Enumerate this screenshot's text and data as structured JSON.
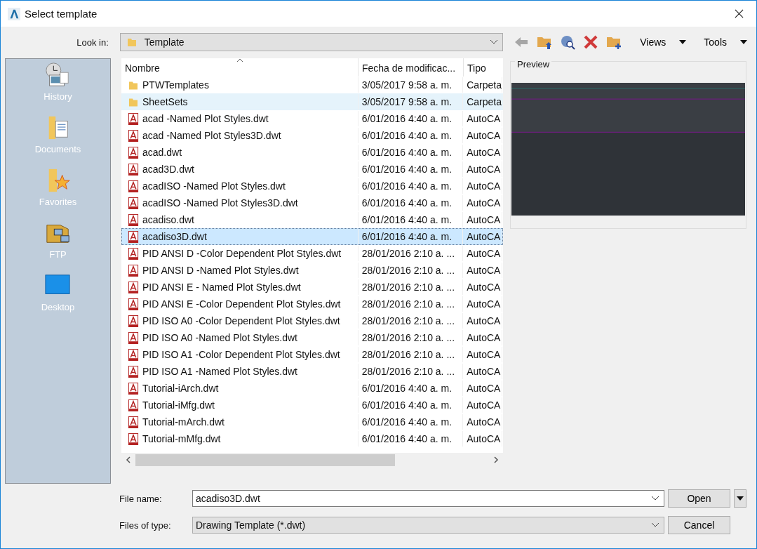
{
  "window": {
    "title": "Select template"
  },
  "look_in": {
    "label": "Look in:",
    "value": "Template"
  },
  "toolbar": {
    "views": "Views",
    "tools": "Tools"
  },
  "places": [
    {
      "label": "History",
      "kind": "history"
    },
    {
      "label": "Documents",
      "kind": "documents"
    },
    {
      "label": "Favorites",
      "kind": "favorites"
    },
    {
      "label": "FTP",
      "kind": "ftp"
    },
    {
      "label": "Desktop",
      "kind": "desktop"
    }
  ],
  "file_list": {
    "columns": [
      "Nombre",
      "Fecha de modificac...",
      "Tipo"
    ],
    "rows": [
      {
        "name": "PTWTemplates",
        "date": "3/05/2017 9:58 a. m.",
        "type": "Carpeta",
        "kind": "folder",
        "selected": false,
        "hovered": false
      },
      {
        "name": "SheetSets",
        "date": "3/05/2017 9:58 a. m.",
        "type": "Carpeta",
        "kind": "folder",
        "selected": false,
        "hovered": true
      },
      {
        "name": "acad -Named Plot Styles.dwt",
        "date": "6/01/2016 4:40 a. m.",
        "type": "AutoCA",
        "kind": "dwt",
        "selected": false,
        "hovered": false
      },
      {
        "name": "acad -Named Plot Styles3D.dwt",
        "date": "6/01/2016 4:40 a. m.",
        "type": "AutoCA",
        "kind": "dwt",
        "selected": false,
        "hovered": false
      },
      {
        "name": "acad.dwt",
        "date": "6/01/2016 4:40 a. m.",
        "type": "AutoCA",
        "kind": "dwt",
        "selected": false,
        "hovered": false
      },
      {
        "name": "acad3D.dwt",
        "date": "6/01/2016 4:40 a. m.",
        "type": "AutoCA",
        "kind": "dwt",
        "selected": false,
        "hovered": false
      },
      {
        "name": "acadISO -Named Plot Styles.dwt",
        "date": "6/01/2016 4:40 a. m.",
        "type": "AutoCA",
        "kind": "dwt",
        "selected": false,
        "hovered": false
      },
      {
        "name": "acadISO -Named Plot Styles3D.dwt",
        "date": "6/01/2016 4:40 a. m.",
        "type": "AutoCA",
        "kind": "dwt",
        "selected": false,
        "hovered": false
      },
      {
        "name": "acadiso.dwt",
        "date": "6/01/2016 4:40 a. m.",
        "type": "AutoCA",
        "kind": "dwt",
        "selected": false,
        "hovered": false
      },
      {
        "name": "acadiso3D.dwt",
        "date": "6/01/2016 4:40 a. m.",
        "type": "AutoCA",
        "kind": "dwt",
        "selected": true,
        "hovered": false
      },
      {
        "name": "PID ANSI D -Color Dependent Plot Styles.dwt",
        "date": "28/01/2016 2:10 a. ...",
        "type": "AutoCA",
        "kind": "dwt",
        "selected": false,
        "hovered": false
      },
      {
        "name": "PID ANSI D -Named Plot Styles.dwt",
        "date": "28/01/2016 2:10 a. ...",
        "type": "AutoCA",
        "kind": "dwt",
        "selected": false,
        "hovered": false
      },
      {
        "name": "PID ANSI E - Named Plot Styles.dwt",
        "date": "28/01/2016 2:10 a. ...",
        "type": "AutoCA",
        "kind": "dwt",
        "selected": false,
        "hovered": false
      },
      {
        "name": "PID ANSI E -Color Dependent Plot Styles.dwt",
        "date": "28/01/2016 2:10 a. ...",
        "type": "AutoCA",
        "kind": "dwt",
        "selected": false,
        "hovered": false
      },
      {
        "name": "PID ISO A0 -Color Dependent Plot Styles.dwt",
        "date": "28/01/2016 2:10 a. ...",
        "type": "AutoCA",
        "kind": "dwt",
        "selected": false,
        "hovered": false
      },
      {
        "name": "PID ISO A0 -Named Plot Styles.dwt",
        "date": "28/01/2016 2:10 a. ...",
        "type": "AutoCA",
        "kind": "dwt",
        "selected": false,
        "hovered": false
      },
      {
        "name": "PID ISO A1 -Color Dependent Plot Styles.dwt",
        "date": "28/01/2016 2:10 a. ...",
        "type": "AutoCA",
        "kind": "dwt",
        "selected": false,
        "hovered": false
      },
      {
        "name": "PID ISO A1 -Named Plot Styles.dwt",
        "date": "28/01/2016 2:10 a. ...",
        "type": "AutoCA",
        "kind": "dwt",
        "selected": false,
        "hovered": false
      },
      {
        "name": "Tutorial-iArch.dwt",
        "date": "6/01/2016 4:40 a. m.",
        "type": "AutoCA",
        "kind": "dwt",
        "selected": false,
        "hovered": false
      },
      {
        "name": "Tutorial-iMfg.dwt",
        "date": "6/01/2016 4:40 a. m.",
        "type": "AutoCA",
        "kind": "dwt",
        "selected": false,
        "hovered": false
      },
      {
        "name": "Tutorial-mArch.dwt",
        "date": "6/01/2016 4:40 a. m.",
        "type": "AutoCA",
        "kind": "dwt",
        "selected": false,
        "hovered": false
      },
      {
        "name": "Tutorial-mMfg.dwt",
        "date": "6/01/2016 4:40 a. m.",
        "type": "AutoCA",
        "kind": "dwt",
        "selected": false,
        "hovered": false
      }
    ]
  },
  "preview": {
    "label": "Preview"
  },
  "file_name": {
    "label": "File name:",
    "value": "acadiso3D.dwt"
  },
  "file_type": {
    "label": "Files of type:",
    "value": "Drawing Template (*.dwt)"
  },
  "buttons": {
    "open": "Open",
    "cancel": "Cancel"
  }
}
